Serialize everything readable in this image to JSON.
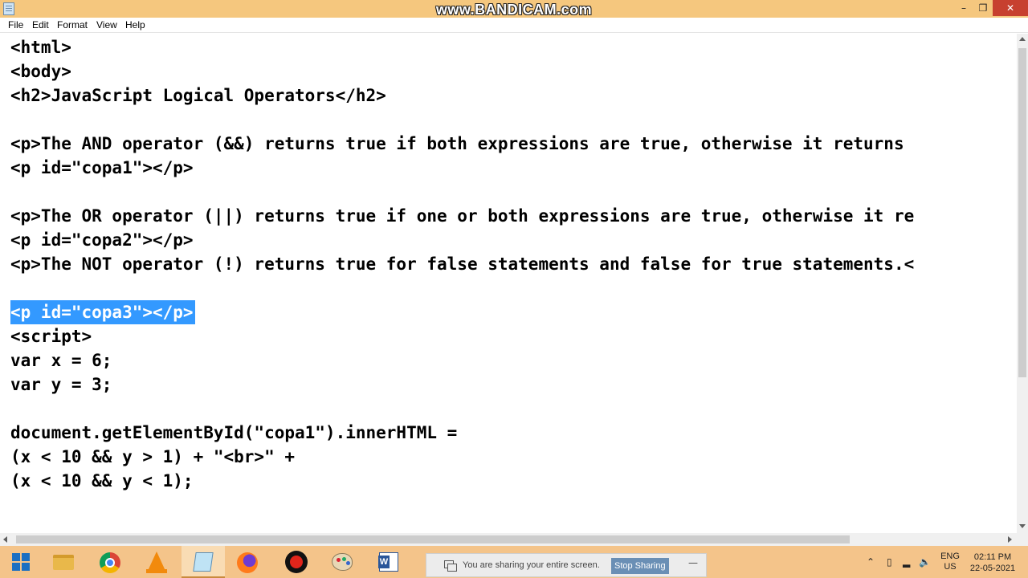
{
  "window": {
    "watermark": "www.BANDICAM.com",
    "minimize_glyph": "–",
    "maximize_glyph": "❐",
    "close_glyph": "✕"
  },
  "menu": [
    "File",
    "Edit",
    "Format",
    "View",
    "Help"
  ],
  "editor": {
    "lines": [
      "<html>",
      "<body>",
      "<h2>JavaScript Logical Operators</h2>",
      "",
      "<p>The AND operator (&&) returns true if both expressions are true, otherwise it returns",
      "<p id=\"copa1\"></p>",
      "",
      "<p>The OR operator (||) returns true if one or both expressions are true, otherwise it re",
      "<p id=\"copa2\"></p>",
      "<p>The NOT operator (!) returns true for false statements and false for true statements.<",
      "",
      "<p id=\"copa3\"></p>",
      "<script>",
      "var x = 6;",
      "var y = 3;",
      "",
      "document.getElementById(\"copa1\").innerHTML =",
      "(x < 10 && y > 1) + \"<br>\" +",
      "(x < 10 && y < 1);"
    ],
    "selected_line_index": 11
  },
  "taskbar": {
    "apps": [
      {
        "name": "start-button",
        "icon": "windows-logo-icon"
      },
      {
        "name": "file-explorer",
        "icon": "folder-icon"
      },
      {
        "name": "google-chrome",
        "icon": "chrome-icon"
      },
      {
        "name": "vlc-media-player",
        "icon": "vlc-cone-icon"
      },
      {
        "name": "notepad",
        "icon": "notepad-icon",
        "active": true
      },
      {
        "name": "firefox",
        "icon": "firefox-icon"
      },
      {
        "name": "bandicam",
        "icon": "record-icon"
      },
      {
        "name": "paint",
        "icon": "paint-palette-icon"
      },
      {
        "name": "microsoft-word",
        "icon": "word-icon"
      }
    ],
    "share_notice": "You are sharing your entire screen.",
    "stop_sharing_label": "Stop Sharing",
    "share_minimize_glyph": "—",
    "language": "ENG",
    "region": "US",
    "time": "02:11 PM",
    "date": "22-05-2021"
  },
  "colors": {
    "titlebar": "#f5c77e",
    "taskbar": "#f4c48a",
    "selection": "#3399ff",
    "close_button": "#c7402f",
    "stop_sharing": "#6a8fb5"
  }
}
